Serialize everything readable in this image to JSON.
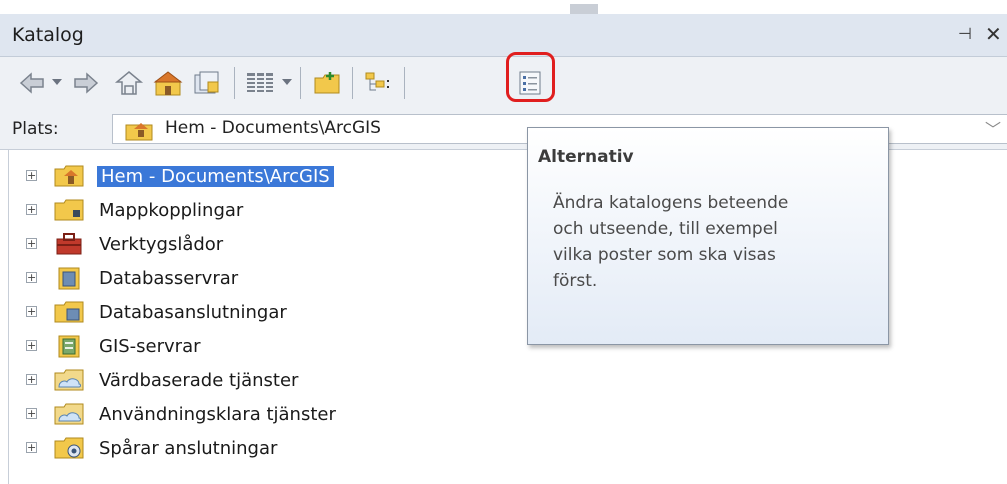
{
  "window": {
    "title": "Katalog",
    "pin_glyph": "⊣",
    "close_glyph": "✕"
  },
  "toolbar": {
    "buttons": [
      "back-arrow-icon",
      "forward-arrow-icon",
      "up-folder-icon",
      "home-folder-icon",
      "catalog-icon",
      "view-grid-icon",
      "new-folder-icon",
      "tree-toggle-icon",
      "options-icon"
    ]
  },
  "location": {
    "label": "Plats:",
    "value": "Hem - Documents\\ArcGIS"
  },
  "tree": {
    "items": [
      {
        "label": "Hem - Documents\\ArcGIS",
        "icon": "home-folder-icon",
        "selected": true
      },
      {
        "label": "Mappkopplingar",
        "icon": "folder-connection-icon",
        "selected": false
      },
      {
        "label": "Verktygslådor",
        "icon": "toolbox-icon",
        "selected": false
      },
      {
        "label": "Databasservrar",
        "icon": "database-server-icon",
        "selected": false
      },
      {
        "label": "Databasanslutningar",
        "icon": "database-connection-icon",
        "selected": false
      },
      {
        "label": "GIS-servrar",
        "icon": "gis-server-icon",
        "selected": false
      },
      {
        "label": "Värdbaserade tjänster",
        "icon": "hosted-services-icon",
        "selected": false
      },
      {
        "label": "Användningsklara tjänster",
        "icon": "ready-services-icon",
        "selected": false
      },
      {
        "label": "Spårar anslutningar",
        "icon": "tracking-connection-icon",
        "selected": false
      }
    ],
    "expander_glyph": "+"
  },
  "tooltip": {
    "title": "Alternativ",
    "lines": [
      "Ändra katalogens beteende",
      "och utseende, till exempel",
      "vilka poster som ska visas",
      "först."
    ]
  },
  "colors": {
    "highlight": "#e01e1e",
    "selection": "#3b78d8",
    "titlebar": "#dfe6f0"
  }
}
